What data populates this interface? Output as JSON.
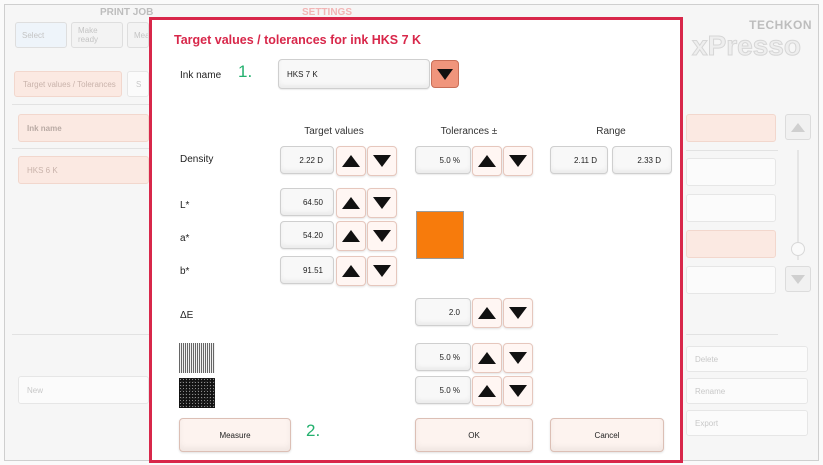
{
  "background": {
    "header_print_job": "PRINT JOB",
    "header_settings": "SETTINGS",
    "tabs": [
      "Select",
      "Make ready",
      "Mea"
    ],
    "subtab_target": "Target values / Tolerances",
    "subtab_partial": "S",
    "list_header": "Ink name",
    "list_item": "HKS 6 K",
    "new_button": "New",
    "delete_button": "Delete",
    "rename_button": "Rename",
    "export_button": "Export",
    "logo_brand": "TECHKON",
    "logo_product": "xPresso"
  },
  "dialog": {
    "title": "Target values / tolerances for ink HKS 7 K",
    "ink_name_label": "Ink name",
    "ink_name_value": "HKS 7 K",
    "step1": "1.",
    "step2": "2.",
    "col_target": "Target values",
    "col_tolerances": "Tolerances ±",
    "col_range": "Range",
    "density_label": "Density",
    "density_value": "2.22 D",
    "density_tolerance": "5.0 %",
    "range_min": "2.11 D",
    "range_max": "2.33 D",
    "l_label": "L*",
    "l_value": "64.50",
    "a_label": "a*",
    "a_value": "54.20",
    "b_label": "b*",
    "b_value": "91.51",
    "color_swatch": "#f77b0c",
    "delta_e_label": "ΔE",
    "delta_e_tolerance": "2.0",
    "pattern1_tolerance": "5.0 %",
    "pattern2_tolerance": "5.0 %",
    "measure_button": "Measure",
    "ok_button": "OK",
    "cancel_button": "Cancel"
  },
  "colors": {
    "accent": "#d8274a",
    "step_number": "#23b06e",
    "dropdown": "#f0957c"
  },
  "icons": [
    "triangle-up-icon",
    "triangle-down-icon",
    "dropdown-arrow-icon"
  ]
}
